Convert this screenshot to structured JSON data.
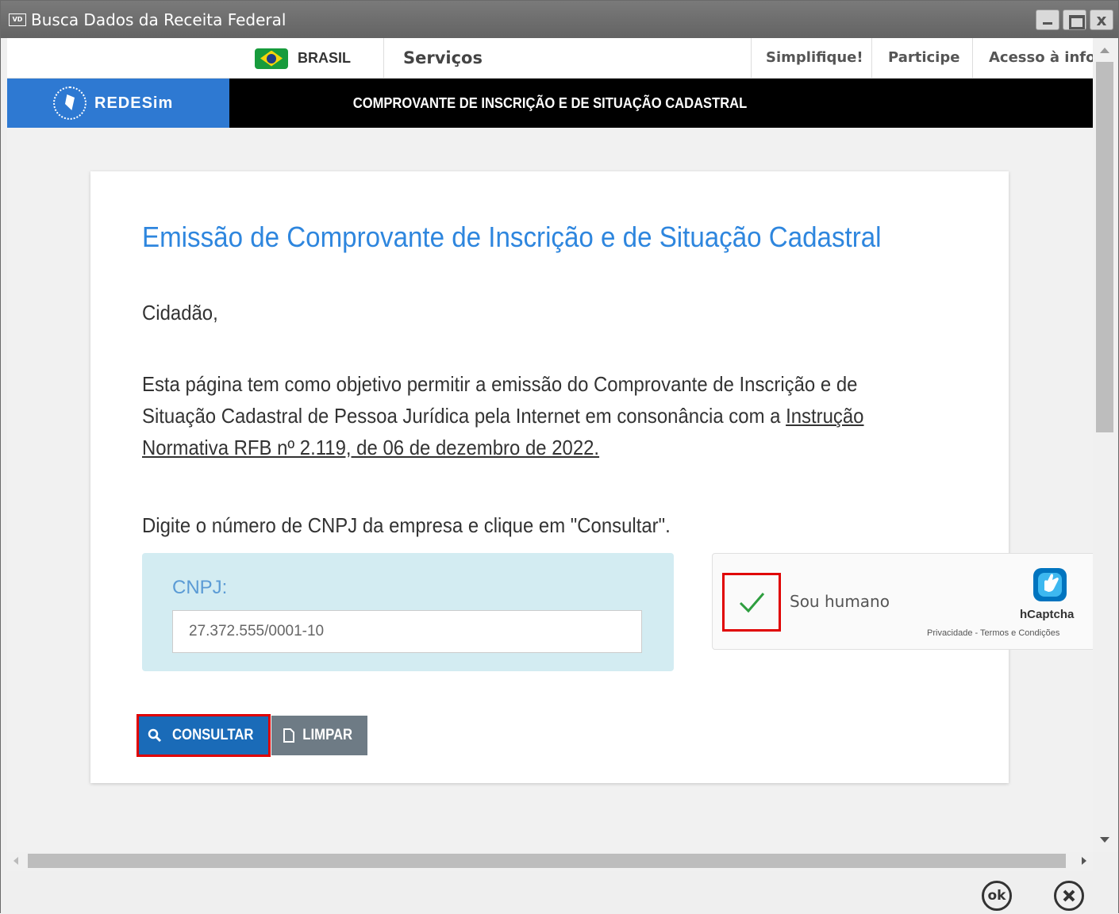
{
  "window": {
    "app_icon": "VD",
    "title": "Busca Dados da Receita Federal",
    "close_glyph": "x"
  },
  "gov_bar": {
    "brasil": "BRASIL",
    "servicos": "Serviços",
    "links": [
      "Simplifique!",
      "Participe",
      "Acesso à infor"
    ]
  },
  "redesim": {
    "logo_text": "REDESim",
    "title": "COMPROVANTE DE INSCRIÇÃO E DE SITUAÇÃO CADASTRAL"
  },
  "content": {
    "heading": "Emissão de Comprovante de Inscrição e de Situação Cadastral",
    "greeting": "Cidadão,",
    "intro_text": "Esta página tem como objetivo permitir a emissão do Comprovante de Inscrição e de Situação Cadastral de Pessoa Jurídica pela Internet em consonância com a ",
    "intro_link": "Instrução Normativa RFB nº 2.119, de 06 de dezembro de 2022.",
    "instruction": "Digite o número de CNPJ da empresa e clique em \"Consultar\"."
  },
  "form": {
    "cnpj_label": "CNPJ:",
    "cnpj_value": "27.372.555/0001-10"
  },
  "captcha": {
    "label": "Sou humano",
    "brand": "hCaptcha",
    "links": "Privacidade - Termos e Condições",
    "checked": true
  },
  "buttons": {
    "consultar": "CONSULTAR",
    "limpar": "LIMPAR"
  },
  "footer": {
    "ok": "ok"
  },
  "colors": {
    "accent": "#2e86de",
    "redesim_blue": "#2e79d2",
    "consultar_bg": "#1a6bb8",
    "highlight_red": "#e00000"
  }
}
